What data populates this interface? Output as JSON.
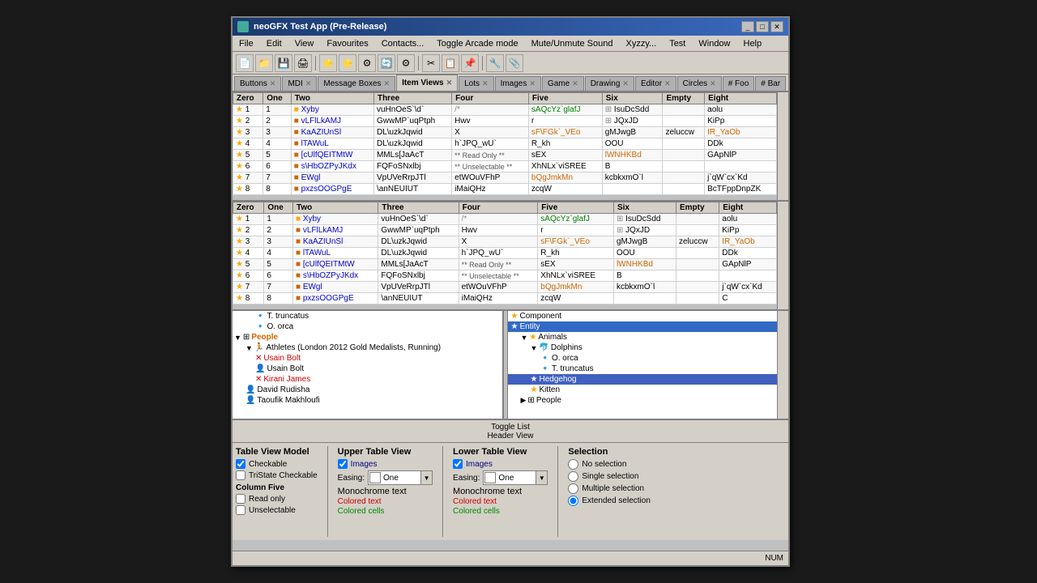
{
  "window": {
    "title": "neoGFX Test App (Pre-Release)",
    "titleIcon": "app-icon"
  },
  "menu": {
    "items": [
      "File",
      "Edit",
      "View",
      "Favourites",
      "Contacts...",
      "Toggle Arcade mode",
      "Mute/Unmute Sound",
      "Xyzzy...",
      "Test",
      "Window",
      "Help"
    ]
  },
  "tabs": [
    {
      "label": "Buttons",
      "active": false
    },
    {
      "label": "MDI",
      "active": false
    },
    {
      "label": "Message Boxes",
      "active": false
    },
    {
      "label": "Item Views",
      "active": true
    },
    {
      "label": "Lots",
      "active": false
    },
    {
      "label": "Images",
      "active": false
    },
    {
      "label": "Game",
      "active": false
    },
    {
      "label": "Drawing",
      "active": false
    },
    {
      "label": "Editor",
      "active": false
    },
    {
      "label": "Circles",
      "active": false
    },
    {
      "label": "# Foo",
      "active": false
    },
    {
      "label": "# Bar",
      "active": false
    }
  ],
  "table": {
    "headers": [
      "Zero",
      "One",
      "Two",
      "Three",
      "Four",
      "Five",
      "Six",
      "Empty",
      "Eight"
    ],
    "rows": [
      [
        "1",
        "1",
        "Xyby",
        "vuHnOeS`\\d`",
        "/*",
        "sAQcYz`glafJ",
        "IsuDcSdd",
        "",
        "aolu"
      ],
      [
        "2",
        "2",
        "vLFlLkAMJ",
        "GwwMP`uqPtph",
        "Hwv",
        "r",
        "JQxJD",
        "",
        "KiPp"
      ],
      [
        "3",
        "3",
        "KaAZIUnSl",
        "DL\\uzkJqwid",
        "X",
        "sF\\FGk`_VEo",
        "gMJwgB",
        "zeluccw",
        "IR_YaOb"
      ],
      [
        "4",
        "4",
        "lTAWuL",
        "DL\\uzkJqwid",
        "h`JPQ_wU`",
        "R_kh",
        "OOU",
        "",
        "DDk"
      ],
      [
        "5",
        "5",
        "[cUlfQEITMtW",
        "MMLs[JaAcT",
        "** Read Only **",
        "sEX",
        "lWNHKBd",
        "",
        "GApNlP"
      ],
      [
        "6",
        "6",
        "s\\HbOZPyJKdx",
        "FQFoSNxlbj",
        "** Unselectable **",
        "XhNLx`viSREE",
        "B",
        "",
        ""
      ],
      [
        "7",
        "7",
        "EWgl",
        "VpUVeRrpJTl",
        "etWOuVFhP",
        "bQgJmkMn",
        "kcbkxmO`l",
        "",
        "j`qW`cx`Kd"
      ],
      [
        "8",
        "8",
        "pxzsOOGPgE",
        "\\anNEUIUT",
        "iMaiQHz",
        "zcqW",
        "",
        "",
        "BcTFppDnpZK"
      ]
    ]
  },
  "tree_left": {
    "items": [
      {
        "indent": 2,
        "label": "T. truncatus",
        "icon": "leaf"
      },
      {
        "indent": 2,
        "label": "O. orca",
        "icon": "leaf"
      },
      {
        "indent": 0,
        "label": "People",
        "icon": "folder",
        "expanded": true
      },
      {
        "indent": 1,
        "label": "Athletes (London 2012 Gold Medalists, Running)",
        "icon": "folder",
        "expanded": true
      },
      {
        "indent": 2,
        "label": "Usain Bolt",
        "icon": "person-x"
      },
      {
        "indent": 2,
        "label": "Usain Bolt",
        "icon": "person"
      },
      {
        "indent": 2,
        "label": "Kirani James",
        "icon": "person-x"
      },
      {
        "indent": 1,
        "label": "David Rudisha",
        "icon": "person"
      },
      {
        "indent": 1,
        "label": "Taoufik Makhloufi",
        "icon": "person"
      }
    ]
  },
  "tree_right": {
    "items": [
      {
        "indent": 0,
        "label": "Component",
        "icon": "star"
      },
      {
        "indent": 0,
        "label": "Entity",
        "icon": "star",
        "selected": true
      },
      {
        "indent": 1,
        "label": "Animals",
        "icon": "star",
        "expanded": true
      },
      {
        "indent": 2,
        "label": "Dolphins",
        "icon": "star",
        "expanded": true
      },
      {
        "indent": 3,
        "label": "O. orca",
        "icon": "leaf"
      },
      {
        "indent": 3,
        "label": "T. truncatus",
        "icon": "leaf"
      },
      {
        "indent": 2,
        "label": "Hedgehog",
        "icon": "star",
        "highlighted": true
      },
      {
        "indent": 2,
        "label": "Kitten",
        "icon": "star"
      },
      {
        "indent": 1,
        "label": "People",
        "icon": "folder"
      }
    ]
  },
  "toggle_bar": {
    "line1": "Toggle List",
    "line2": "Header View"
  },
  "table_view_model": {
    "title": "Table View Model",
    "checkable": {
      "label": "Checkable",
      "checked": true
    },
    "tristate": {
      "label": "TriState Checkable",
      "checked": false
    },
    "column_five": {
      "title": "Column Five"
    },
    "read_only": {
      "label": "Read only",
      "checked": false
    },
    "unselectable": {
      "label": "Unselectable",
      "checked": false
    }
  },
  "upper_table_view": {
    "title": "Upper Table View",
    "images": {
      "label": "Images",
      "checked": true
    },
    "easing_label": "Easing:",
    "easing_value": "One",
    "monochrome_text": "Monochrome text",
    "colored_text": "Colored text",
    "colored_cells": "Colored cells"
  },
  "lower_table_view": {
    "title": "Lower Table View",
    "images": {
      "label": "Images",
      "checked": true
    },
    "easing_label": "Easing:",
    "easing_value": "One",
    "monochrome_text": "Monochrome text",
    "colored_text": "Colored text",
    "colored_cells": "Colored cells"
  },
  "selection": {
    "title": "Selection",
    "no_selection": "No selection",
    "single_selection": "Single selection",
    "multiple_selection": "Multiple selection",
    "extended_selection": "Extended selection"
  },
  "status_bar": {
    "num": "NUM"
  }
}
